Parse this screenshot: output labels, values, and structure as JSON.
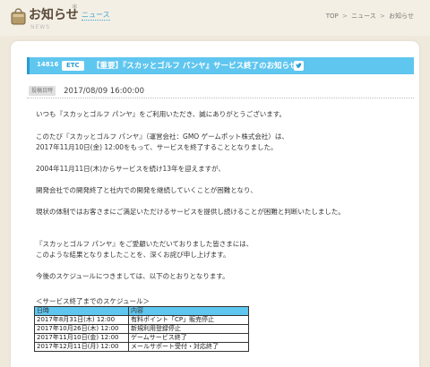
{
  "header": {
    "title": "お知らせ",
    "star": "*",
    "subtitle": "ニュース",
    "title_en": "NEWS",
    "breadcrumb": [
      "TOP",
      "ニュース",
      "お知らせ"
    ],
    "breadcrumb_sep": ">"
  },
  "article": {
    "id": "14816",
    "category": "ETC",
    "title": "【重要】『スカッとゴルフ パンヤ』サービス終了のお知らせ",
    "date_label": "投稿日時",
    "date": "2017/08/09 16:00:00",
    "paragraphs": [
      "いつも『スカッとゴルフ パンヤ』をご利用いただき、誠にありがとうございます。",
      "このたび『スカッとゴルフ パンヤ』（運営会社：GMO ゲームポット株式会社）は、",
      "2017年11月10日(金) 12:00をもって、サービスを終了することとなりました。",
      "2004年11月11日(木)からサービスを続け13年を迎えますが、",
      "開発会社での開発終了と社内での開発を継続していくことが困難となり、",
      "現状の体制ではお客さまにご満足いただけるサービスを提供し続けることが困難と判断いたしました。",
      "『スカッとゴルフ パンヤ』をご愛顧いただいておりました皆さまには、",
      "このような結果となりましたことを、深くお詫び申し上げます。",
      "今後のスケジュールにつきましては、以下のとおりとなります。"
    ],
    "schedule_title": "＜サービス終了までのスケジュール＞",
    "schedule_headers": [
      "日時",
      "内容"
    ],
    "schedule_rows": [
      [
        "2017年8月31日(木) 12:00",
        "有料ポイント「CP」販売停止"
      ],
      [
        "2017年10月26日(木) 12:00",
        "新規利用登録停止"
      ],
      [
        "2017年11月10日(金) 12:00",
        "ゲームサービス終了"
      ],
      [
        "2017年12月11日(月) 12:00",
        "メールサポート受付・対応終了"
      ]
    ]
  },
  "colors": {
    "accent": "#5fc6ef",
    "accent_dark": "#2b9ccf",
    "background": "#efe9dc",
    "link": "#3aa7d6"
  }
}
